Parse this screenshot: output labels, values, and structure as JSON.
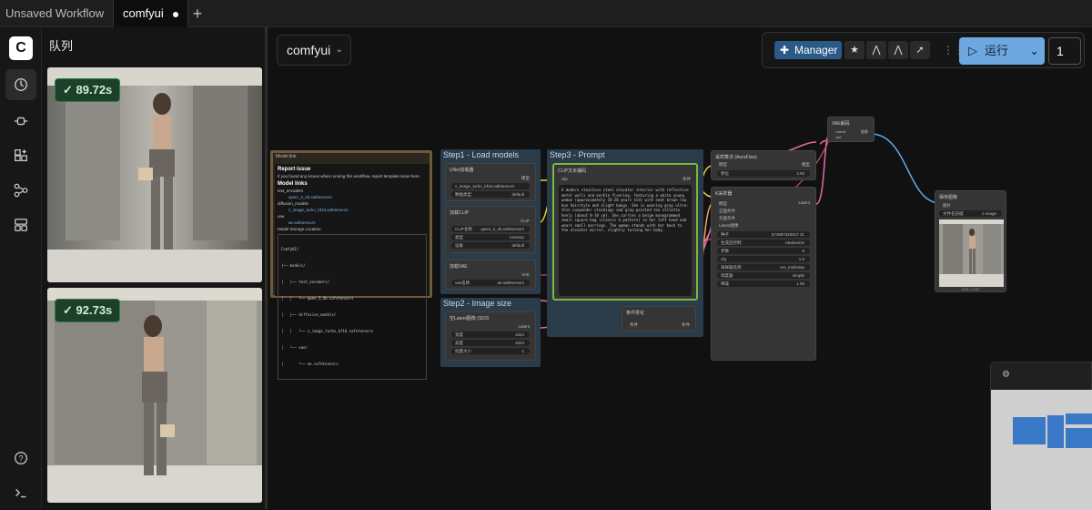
{
  "tabs": [
    {
      "label": "Unsaved Workflow",
      "modified": true
    },
    {
      "label": "comfyui",
      "modified": true,
      "active": true
    }
  ],
  "rail": {
    "logo": "C",
    "icons": [
      "history-icon",
      "node-library-icon",
      "model-library-icon",
      "workflows-icon",
      "templates-icon",
      "help-icon",
      "terminal-icon"
    ]
  },
  "queue": {
    "title": "队列",
    "items": [
      {
        "time": "89.72s"
      },
      {
        "time": "92.73s"
      }
    ]
  },
  "canvas": {
    "workflow_name": "comfyui",
    "toolbar": {
      "manager_label": "Manager",
      "run_label": "运行",
      "run_count": "1"
    },
    "groups": {
      "model_link": "Model link",
      "step1": "Step1 - Load models",
      "step2": "Step2 - Image size",
      "step3": "Step3 - Prompt"
    },
    "notes": {
      "report_title": "Report issue",
      "report_text": "If you found any issues when running this workflow, report template issue here",
      "model_links_title": "Model links",
      "text_encoders": "text_encoders",
      "qwen": "qwen_3_4b.safetensors",
      "diffusion_models": "diffusion_models",
      "z_image": "z_image_turbo_bf16.safetensors",
      "vae": "vae",
      "ae": "ae.safetensors",
      "storage": "Model Storage Location",
      "tree": [
        "ComfyUI/",
        "├── models/",
        "│   ├── text_encoders/",
        "│   │   └── qwen_3_4b.safetensors",
        "│   ├── diffusion_models/",
        "│   │   └── z_image_turbo_bf16.safetensors",
        "│   └── vae/",
        "│       └── ae.safetensors"
      ]
    },
    "nodes": {
      "unet": {
        "title": "UNet加载器",
        "out": "模型",
        "field1": "z_image_turbo_bf16.safetensors",
        "field2_label": "数据类型",
        "field2_value": "default"
      },
      "clip": {
        "title": "加载CLIP",
        "out": "CLIP",
        "f1_label": "CLIP名称",
        "f1_value": "qwen_3_4b.safetensors",
        "f2_label": "类型",
        "f2_value": "lumina2",
        "f3_label": "设备",
        "f3_value": "default"
      },
      "vae_loader": {
        "title": "加载VAE",
        "out": "VAE",
        "f1_label": "vae名称",
        "f1_value": "ae.safetensors"
      },
      "latent": {
        "title": "空Latent图像 (SD3)",
        "out": "Latent",
        "w_label": "宽度",
        "w_value": "1024",
        "h_label": "高度",
        "h_value": "1024",
        "b_label": "批量大小",
        "b_value": "1"
      },
      "clip_text": {
        "title": "CLIP文本编码",
        "in": "clip",
        "out": "条件",
        "prompt": "A modern stainless steel elevator interior with reflective metal walls and marble flooring, featuring a white young woman (approximately 18-20 years old) with neat brown low bun hairstyle and slight bangs. She is wearing gray ultra-thin suspender stockings and gray pointed toe stiletto heels (about 8-10 cm). She carries a beige monogrammed small square bag (classic G pattern) in her left hand and wears small earrings. The woman stands with her back to the elevator mirror, slightly turning her body."
      },
      "cond_zero": {
        "title": "条件零化",
        "in": "条件",
        "out": "条件"
      },
      "sampling": {
        "title": "采样算法 (AuraFlow)",
        "in": "模型",
        "out": "模型",
        "f_label": "移位",
        "f_value": "3.00"
      },
      "ksampler": {
        "title": "K采样器",
        "out": "Latent",
        "in1": "模型",
        "in2": "正面条件",
        "in3": "负面条件",
        "in4": "Latent图像",
        "seed_label": "种子",
        "seed_value": "574897320817 31",
        "ctrl_label": "生成后控制",
        "ctrl_value": "randomize",
        "steps_label": "步数",
        "steps_value": "9",
        "cfg_label": "cfg",
        "cfg_value": "1.0",
        "sampler_label": "采样器名称",
        "sampler_value": "res_multistep",
        "sched_label": "调度器",
        "sched_value": "simple",
        "denoise_label": "降噪",
        "denoise_value": "1.00"
      },
      "vae_decode": {
        "title": "VAE解码",
        "in1": "Latent",
        "in2": "vae",
        "out": "图像"
      },
      "save": {
        "title": "保存图像",
        "in": "图片",
        "f_label": "文件名前缀",
        "f_value": "z-image",
        "size": "1024 × 1024"
      }
    }
  },
  "colors": {
    "link_yellow": "#e8d23a",
    "link_pink": "#e36aa8",
    "link_blue": "#5fa9e8",
    "link_red": "#e35d5d",
    "link_orange": "#f0a860",
    "badge_green": "#2f7d45",
    "run_blue": "#6ea8e0"
  }
}
